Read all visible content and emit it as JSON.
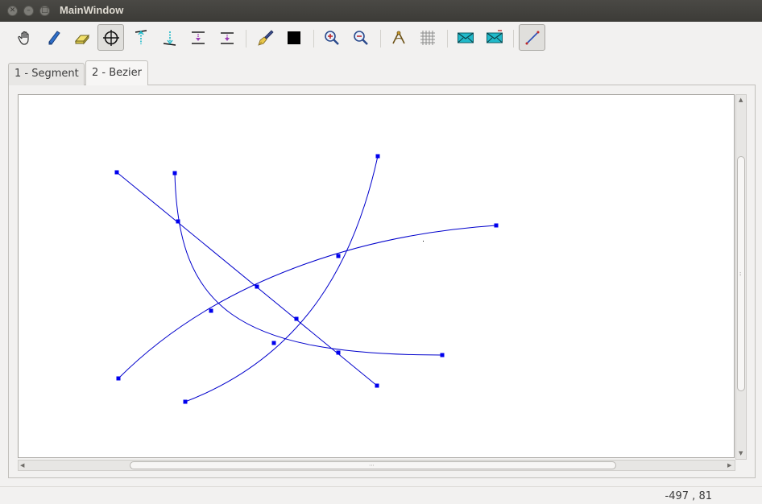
{
  "window": {
    "title": "MainWindow",
    "buttons": [
      "close",
      "minimize",
      "maximize"
    ]
  },
  "toolbar": {
    "tools": [
      {
        "name": "hand-icon"
      },
      {
        "name": "pencil-icon"
      },
      {
        "name": "eraser-icon"
      },
      {
        "name": "crosshair-icon",
        "active": true
      },
      {
        "name": "vertical-dimension-top-icon"
      },
      {
        "name": "vertical-dimension-bottom-icon"
      },
      {
        "name": "insert-above-icon"
      },
      {
        "name": "insert-below-icon"
      },
      {
        "name": "paintbrush-icon"
      },
      {
        "name": "black-square-icon"
      },
      {
        "name": "zoom-in-icon"
      },
      {
        "name": "zoom-out-icon"
      },
      {
        "name": "compass-icon"
      },
      {
        "name": "grid-icon"
      },
      {
        "name": "mail-icon"
      },
      {
        "name": "mail-alt-icon"
      },
      {
        "name": "line-tool-icon",
        "active": true
      }
    ]
  },
  "tabs": [
    {
      "label": "1 - Segment",
      "selected": false
    },
    {
      "label": "2 - Bezier",
      "selected": true
    }
  ],
  "canvas": {
    "background": "#ffffff",
    "curve_color": "#0000cc",
    "point_color": "#0000ee"
  },
  "statusbar": {
    "coords": "-497 , 81"
  }
}
